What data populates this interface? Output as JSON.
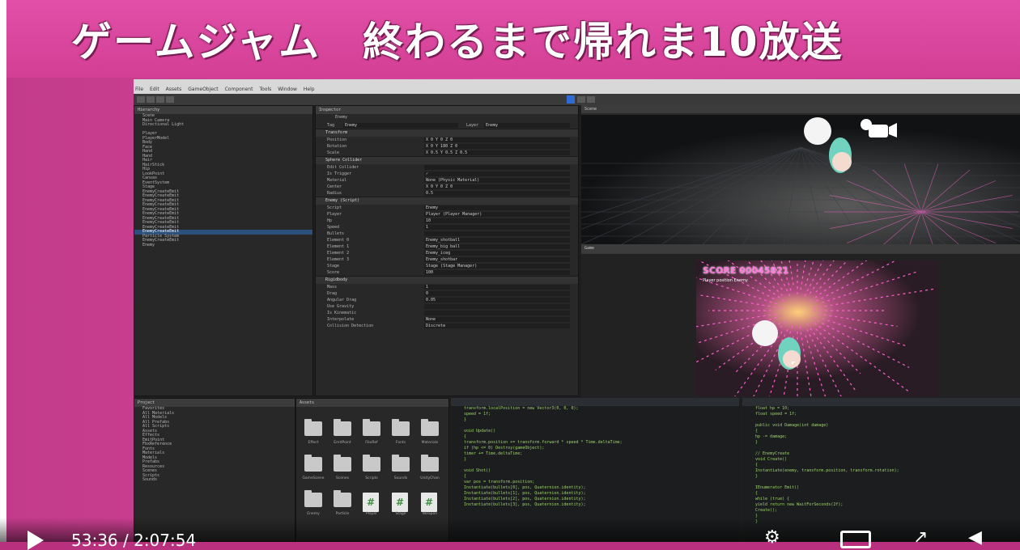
{
  "banner": {
    "title": "ゲームジャム　終わるまで帰れま10放送"
  },
  "player": {
    "time": "53:36 / 2:07:54",
    "play_icon": "play-icon",
    "settings_icon": "gear-icon",
    "theater_icon": "theater-mode-icon",
    "fullscreen_icon": "fullscreen-icon",
    "volume_icon": "volume-icon"
  },
  "editor": {
    "menus": [
      "File",
      "Edit",
      "Assets",
      "GameObject",
      "Component",
      "Tools",
      "Window",
      "Help"
    ],
    "panels": {
      "hierarchy": "Hierarchy",
      "inspector": "Inspector",
      "scene": "Scene",
      "game": "Game",
      "project": "Project",
      "assets": "Assets"
    },
    "inspector": {
      "object_name": "Enemy",
      "tag_label": "Tag",
      "tag_value": "Enemy",
      "layer_label": "Layer",
      "layer_value": "Enemy",
      "sections": [
        {
          "title": "Transform",
          "rows": [
            {
              "label": "Position",
              "value": "X 0    Y 0    Z 0"
            },
            {
              "label": "Rotation",
              "value": "X 0    Y 180    Z 0"
            },
            {
              "label": "Scale",
              "value": "X 0.5    Y 0.5    Z 0.5"
            }
          ]
        },
        {
          "title": "Sphere Collider",
          "rows": [
            {
              "label": "Edit Collider",
              "value": ""
            },
            {
              "label": "Is Trigger",
              "value": "✓"
            },
            {
              "label": "Material",
              "value": "None (Physic Material)"
            },
            {
              "label": "Center",
              "value": "X 0    Y 0    Z 0"
            },
            {
              "label": "Radius",
              "value": "0.5"
            }
          ]
        },
        {
          "title": "Enemy (Script)",
          "rows": [
            {
              "label": "Script",
              "value": "Enemy"
            },
            {
              "label": "Player",
              "value": "Player (Player Manager)"
            },
            {
              "label": "Hp",
              "value": "10"
            },
            {
              "label": "Speed",
              "value": "1"
            },
            {
              "label": "Bullets",
              "value": ""
            },
            {
              "label": "Element 0",
              "value": "Enemy_shotball"
            },
            {
              "label": "Element 1",
              "value": "Enemy_big ball"
            },
            {
              "label": "Element 2",
              "value": "Enemy_iceg"
            },
            {
              "label": "Element 3",
              "value": "Enemy_shotbar"
            },
            {
              "label": "Stage",
              "value": "Stage (Stage Manager)"
            },
            {
              "label": "Score",
              "value": "100"
            }
          ]
        },
        {
          "title": "Rigidbody",
          "rows": [
            {
              "label": "Mass",
              "value": "1"
            },
            {
              "label": "Drag",
              "value": "0"
            },
            {
              "label": "Angular Drag",
              "value": "0.05"
            },
            {
              "label": "Use Gravity",
              "value": ""
            },
            {
              "label": "Is Kinematic",
              "value": ""
            },
            {
              "label": "Interpolate",
              "value": "None"
            },
            {
              "label": "Collision Detection",
              "value": "Discrete"
            }
          ]
        }
      ]
    },
    "hierarchy_items": [
      "Scene",
      "Main Camera",
      "Directional Light",
      "",
      "Player",
      "PlayerModel",
      "Body",
      "Face",
      "Hand",
      "Hand",
      "Hair",
      "HairStick",
      "Hip",
      "LookPoint",
      "Canvas",
      "EventSystem",
      "Stage",
      "EnemyCreateEmit",
      "EnemyCreateEmit",
      "EnemyCreateEmit",
      "EnemyCreateEmit",
      "EnemyCreateEmit",
      "EnemyCreateEmit",
      "EnemyCreateEmit",
      "EnemyCreateEmit",
      "EnemyCreateEmit",
      "EnemyCreateEmit",
      "Particle System",
      "EnemyCreateEmit",
      "Enemy"
    ],
    "project_items": [
      "Favorites",
      "All Materials",
      "All Models",
      "All Prefabs",
      "All Scripts",
      "Assets",
      "Effects",
      "EmitPoint",
      "FbxReference",
      "Fonts",
      "Materials",
      "Models",
      "Prefabs",
      "Resources",
      "Scenes",
      "Scripts",
      "Sounds"
    ],
    "assets": [
      "Effect",
      "EmitPoint",
      "FbxRef",
      "Fonts",
      "Materials",
      "GameScene",
      "Scenes",
      "Scripts",
      "Sounds",
      "UnityChan",
      "Enemy",
      "Particle",
      "Player",
      "Stage",
      "Weapon"
    ],
    "game_score": "SCORE 00045821",
    "game_sub": "Player position Enemy",
    "code_left": [
      "    transform.localPosition = new Vector3(0, 0, 0);",
      "    speed = 1f;",
      "}",
      "",
      "void Update()",
      "{",
      "    transform.position += transform.forward * speed * Time.deltaTime;",
      "    if (hp <= 0) Destroy(gameObject);",
      "    timer += Time.deltaTime;",
      "}",
      "",
      "void Shot()",
      "{",
      "    var pos = transform.position;",
      "    Instantiate(bullets[0], pos, Quaternion.identity);",
      "    Instantiate(bullets[1], pos, Quaternion.identity);",
      "    Instantiate(bullets[2], pos, Quaternion.identity);",
      "    Instantiate(bullets[3], pos, Quaternion.identity);"
    ],
    "code_right": [
      "float hp = 10;",
      "float speed = 1f;",
      "",
      "public void Damage(int damage)",
      "{",
      "    hp -= damage;",
      "}",
      "",
      "// EnemyCreate",
      "void Create()",
      "{",
      "    Instantiate(enemy, transform.position, transform.rotation);",
      "}",
      "",
      "IEnumerator Emit()",
      "{",
      "    while (true) {",
      "        yield return new WaitForSeconds(2f);",
      "        Create();",
      "    }",
      "}"
    ]
  },
  "colors": {
    "accent": "#d9449c",
    "play": "#2f6bd1",
    "code_green": "#9fd36b",
    "score_pink": "#ff77dd"
  }
}
